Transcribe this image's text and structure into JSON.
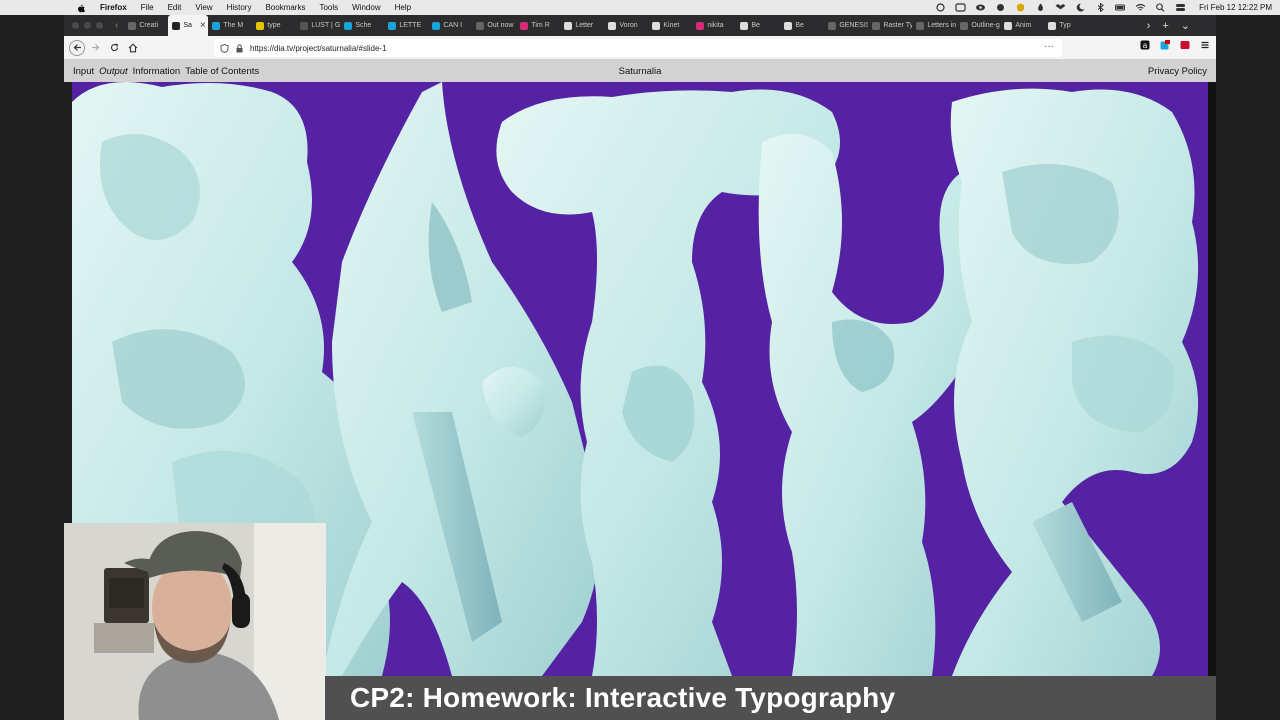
{
  "menubar": {
    "app": "Firefox",
    "items": [
      "File",
      "Edit",
      "View",
      "History",
      "Bookmarks",
      "Tools",
      "Window",
      "Help"
    ],
    "clock": "Fri Feb 12  12:22 PM"
  },
  "tabs": [
    {
      "label": "Creati",
      "color": "#666"
    },
    {
      "label": "Sa",
      "color": "#222",
      "active": true
    },
    {
      "label": "The M",
      "color": "#1aa3d8"
    },
    {
      "label": "type",
      "color": "#e2c400"
    },
    {
      "label": "LUST | Gr",
      "color": "#555"
    },
    {
      "label": "Sche",
      "color": "#1aa3d8"
    },
    {
      "label": "LETTE",
      "color": "#1aa3d8"
    },
    {
      "label": "CAN I",
      "color": "#1aa3d8"
    },
    {
      "label": "Out now",
      "color": "#666"
    },
    {
      "label": "Tim R",
      "color": "#d62976"
    },
    {
      "label": "Letter",
      "color": "#ddd"
    },
    {
      "label": "Voron",
      "color": "#ddd"
    },
    {
      "label": "Kinet",
      "color": "#ddd"
    },
    {
      "label": "nikita",
      "color": "#d62976"
    },
    {
      "label": "Be",
      "color": "#ddd"
    },
    {
      "label": "Be",
      "color": "#ddd"
    },
    {
      "label": "GENESIS",
      "color": "#666"
    },
    {
      "label": "Raster Typ",
      "color": "#666"
    },
    {
      "label": "Letters in",
      "color": "#666"
    },
    {
      "label": "Outline-g",
      "color": "#666"
    },
    {
      "label": "Anim",
      "color": "#ddd"
    },
    {
      "label": "Typ",
      "color": "#ddd"
    }
  ],
  "navbar": {
    "url": "https://dia.tv/project/saturnalia/#slide-1"
  },
  "site": {
    "nav": [
      "Input",
      "Output",
      "Information",
      "Table of Contents"
    ],
    "title": "Saturnalia",
    "privacy": "Privacy Policy"
  },
  "canvas": {
    "background": "#5522a4",
    "shape_color": "#c8ecea"
  },
  "caption": {
    "text": "CP2: Homework: Interactive Typography"
  }
}
